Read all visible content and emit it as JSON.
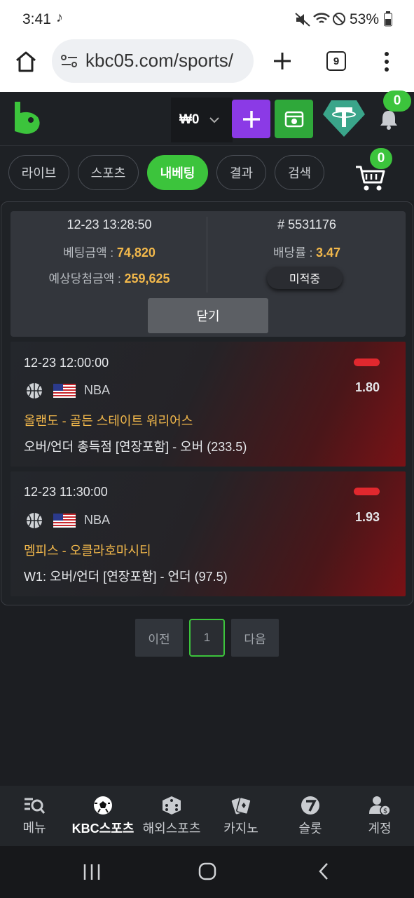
{
  "status": {
    "time": "3:41",
    "battery": "53%"
  },
  "browser": {
    "url": "kbc05.com/sports/",
    "tab_count": "9"
  },
  "header": {
    "balance": "₩0",
    "notification_count": "0"
  },
  "tabs": [
    {
      "label": "라이브"
    },
    {
      "label": "스포츠"
    },
    {
      "label": "내베팅"
    },
    {
      "label": "결과"
    },
    {
      "label": "검색"
    }
  ],
  "cart_count": "0",
  "summary": {
    "datetime": "12-23 13:28:50",
    "bet_id": "# 5531176",
    "bet_amount_label": "베팅금액 :",
    "bet_amount": "74,820",
    "odds_label": "배당률 :",
    "odds": "3.47",
    "expected_label": "예상당첨금액 :",
    "expected": "259,625",
    "status": "미적중",
    "close": "닫기"
  },
  "bets": [
    {
      "datetime": "12-23 12:00:00",
      "league": "NBA",
      "odds": "1.80",
      "match": "올랜도 - 골든 스테이트 워리어스",
      "market": "오버/언더 총득점 [연장포함] - 오버 (233.5)"
    },
    {
      "datetime": "12-23 11:30:00",
      "league": "NBA",
      "odds": "1.93",
      "match": "멤피스 - 오클라호마시티",
      "market": "W1: 오버/언더 [연장포함] - 언더 (97.5)"
    }
  ],
  "pager": {
    "prev": "이전",
    "page": "1",
    "next": "다음"
  },
  "nav": [
    {
      "label": "메뉴"
    },
    {
      "label": "KBC스포츠"
    },
    {
      "label": "해외스포츠"
    },
    {
      "label": "카지노"
    },
    {
      "label": "슬롯"
    },
    {
      "label": "계정"
    }
  ],
  "colors": {
    "accent": "#3cc43c",
    "gold": "#f2b84b",
    "loss": "#e0282e",
    "purple": "#8b3ae6"
  }
}
